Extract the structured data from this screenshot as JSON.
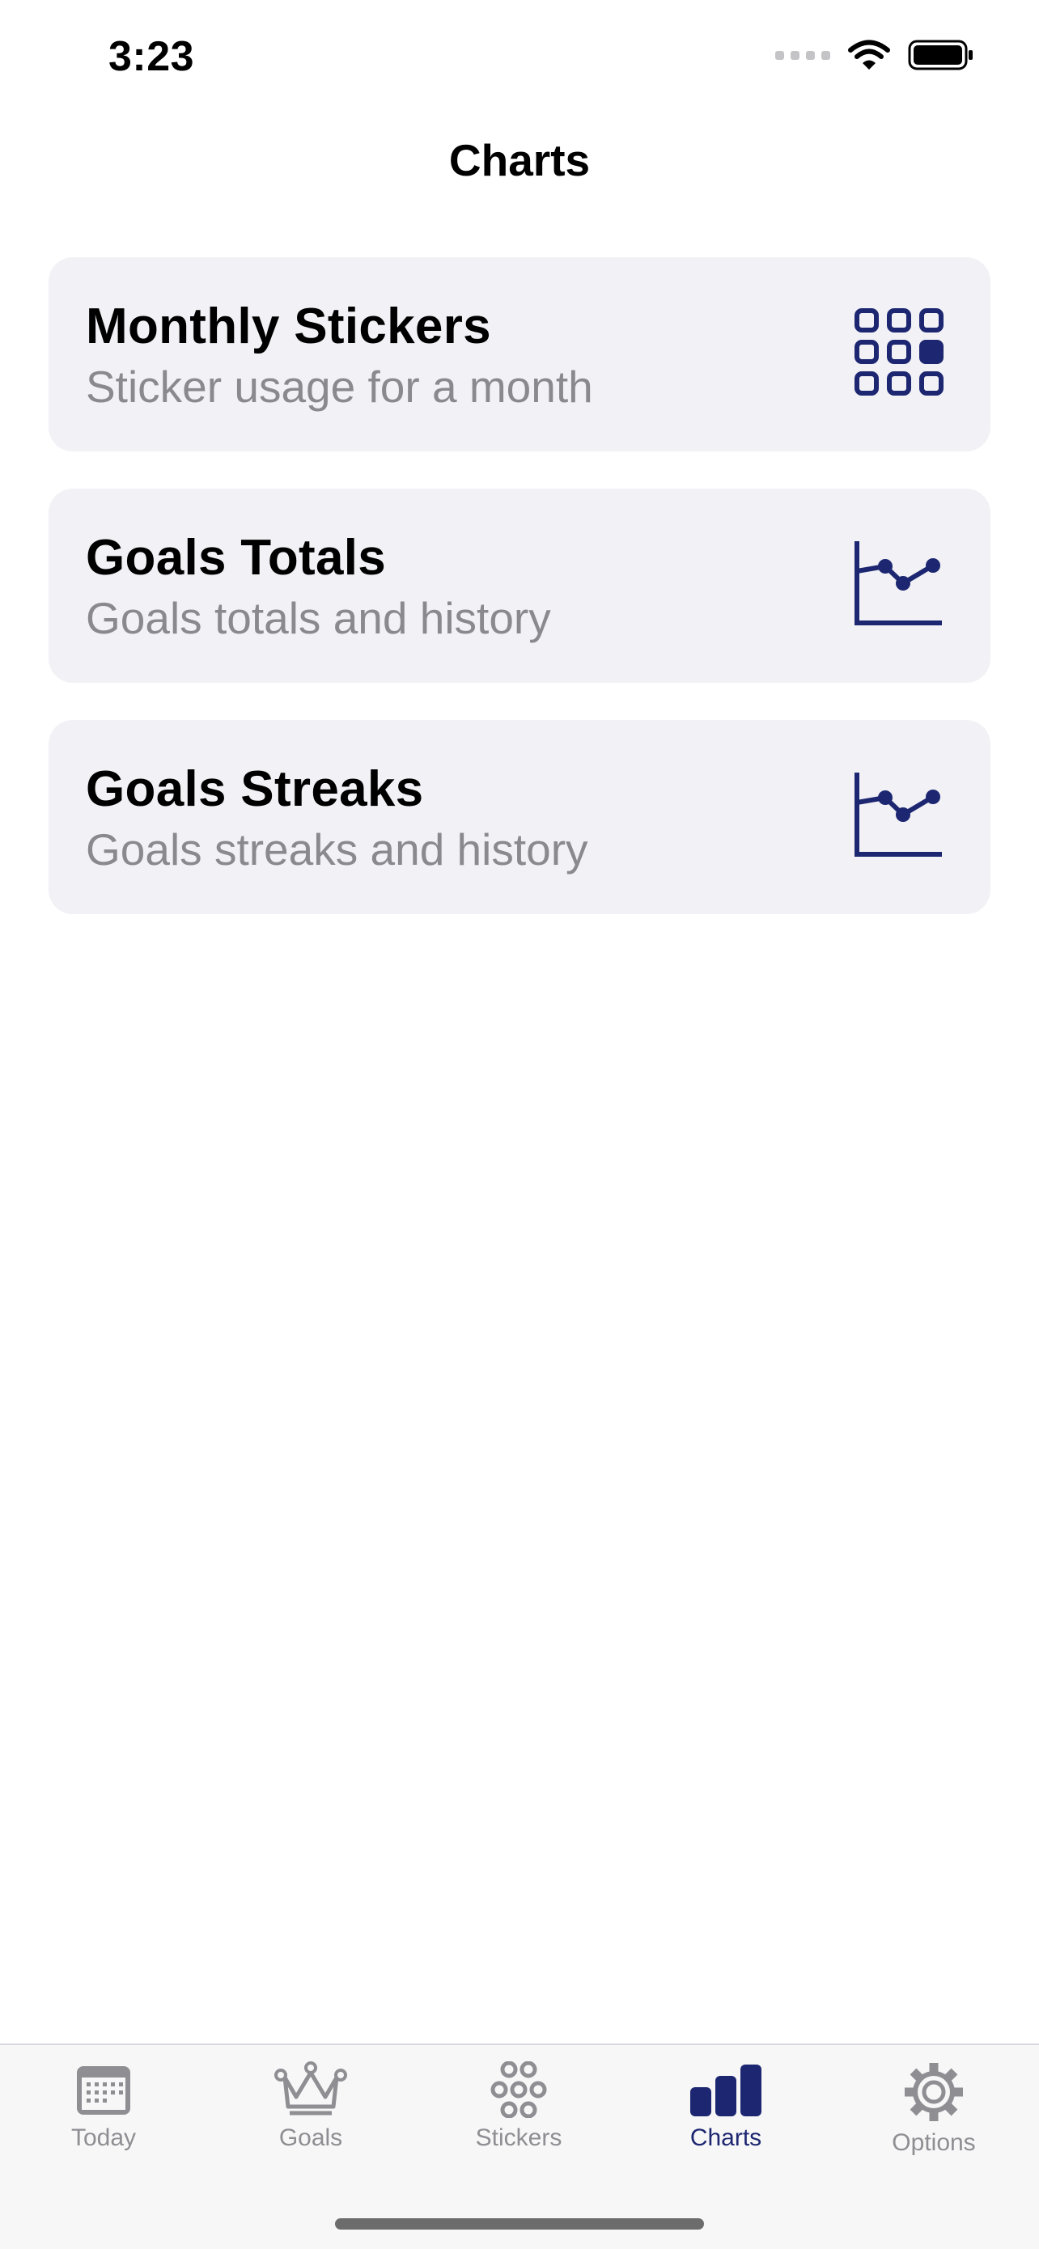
{
  "status_bar": {
    "time": "3:23"
  },
  "nav": {
    "title": "Charts"
  },
  "cards": [
    {
      "title": "Monthly Stickers",
      "subtitle": "Sticker usage for a month",
      "icon": "grid-icon"
    },
    {
      "title": "Goals Totals",
      "subtitle": "Goals totals and history",
      "icon": "line-chart-icon"
    },
    {
      "title": "Goals Streaks",
      "subtitle": "Goals streaks and history",
      "icon": "line-chart-icon"
    }
  ],
  "tabs": [
    {
      "label": "Today",
      "icon": "calendar-icon",
      "active": false
    },
    {
      "label": "Goals",
      "icon": "crown-icon",
      "active": false
    },
    {
      "label": "Stickers",
      "icon": "flower-icon",
      "active": false
    },
    {
      "label": "Charts",
      "icon": "bar-chart-icon",
      "active": true
    },
    {
      "label": "Options",
      "icon": "gear-icon",
      "active": false
    }
  ],
  "colors": {
    "accent": "#1d2771",
    "inactive": "#8e8e93",
    "card_bg": "#f1f1f6"
  }
}
